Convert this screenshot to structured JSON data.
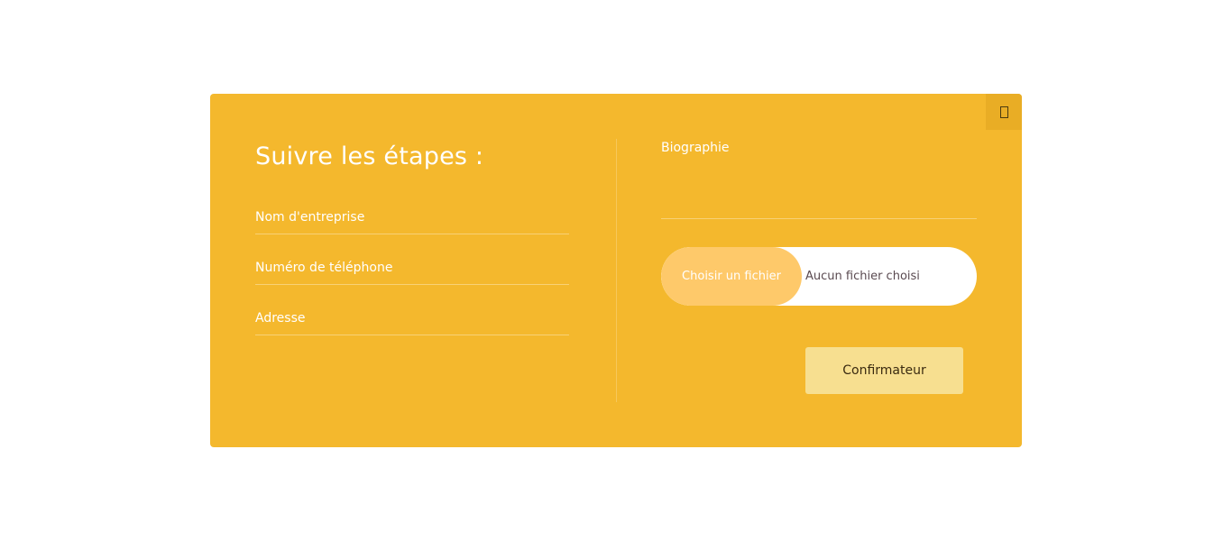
{
  "modal": {
    "title": "Suivre les étapes :",
    "close_icon": "close-icon"
  },
  "form": {
    "company_label": "Nom d'entreprise",
    "phone_label": "Numéro de téléphone",
    "address_label": "Adresse",
    "bio_label": "Biographie",
    "file_button_label": "Choisir un fichier",
    "file_status": "Aucun fichier choisi",
    "confirm_label": "Confirmateur"
  },
  "colors": {
    "modal_bg": "#f4b82d",
    "file_button_bg": "#fec96a",
    "confirm_bg": "#f7df90"
  }
}
